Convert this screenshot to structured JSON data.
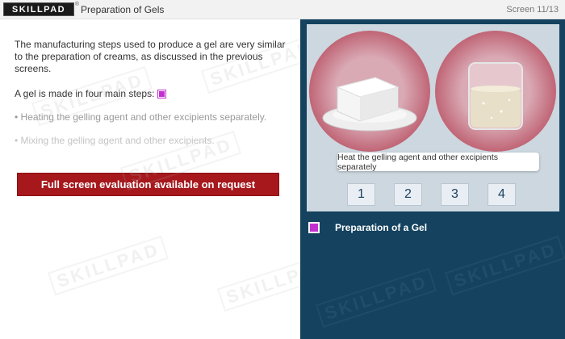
{
  "header": {
    "logo_text": "SKILLPAD",
    "logo_mark": "®",
    "title": "Preparation of Gels",
    "screen_counter": "Screen 11/13"
  },
  "content": {
    "intro": "The manufacturing steps used to produce a gel are very similar to the preparation of creams, as discussed in the previous screens.",
    "lead": "A gel is made in four main steps:",
    "steps": [
      "• Heating the gelling agent and other excipients separately.",
      "• Mixing the gelling agent and other excipients."
    ],
    "eval_banner": "Full screen evaluation available on request"
  },
  "panel": {
    "tooltip": "Heat the gelling agent and other excipients separately",
    "step_buttons": [
      "1",
      "2",
      "3",
      "4"
    ],
    "caption": "Preparation of a Gel"
  },
  "watermark": "SKILLPAD",
  "colors": {
    "header_bg": "#f2f2f2",
    "panel_bg": "#14425f",
    "banner_red": "#a6181c",
    "marker_magenta": "#c22fd0",
    "circle_red": "#a8243a"
  }
}
